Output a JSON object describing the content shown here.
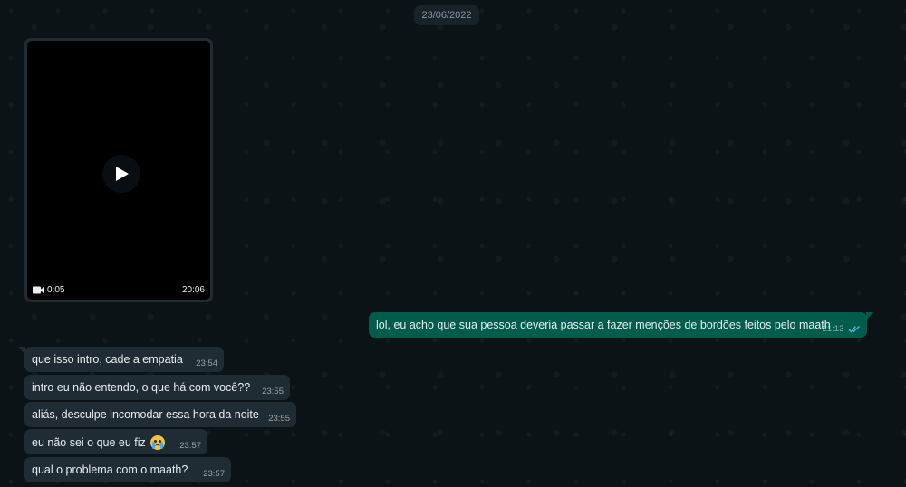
{
  "chat": {
    "date_label": "23/06/2022",
    "video": {
      "duration": "0:05",
      "time": "20:06",
      "icon": "video-camera-icon",
      "play_icon": "play-icon"
    },
    "outgoing_message": {
      "text": "lol, eu acho que sua pessoa deveria passar a fazer menções de bordões feitos pelo maath",
      "time": "21:13",
      "status_icon": "double-check-icon"
    },
    "incoming_messages": [
      {
        "text": "que isso intro, cade a empatia",
        "time": "23:54"
      },
      {
        "text": "intro eu não entendo, o que há com você??",
        "time": "23:55"
      },
      {
        "text": "aliás, desculpe incomodar essa hora da noite",
        "time": "23:55"
      },
      {
        "text": "eu não sei o que eu fiz",
        "time": "23:57",
        "emoji": "loudly-crying-face-emoji"
      },
      {
        "text": "qual o problema com o maath?",
        "time": "23:57"
      }
    ]
  },
  "colors": {
    "background": "#0b141a",
    "incoming_bubble": "#202c33",
    "outgoing_bubble": "#005c4b",
    "text": "#e9edef",
    "read_check": "#53bdeb"
  }
}
